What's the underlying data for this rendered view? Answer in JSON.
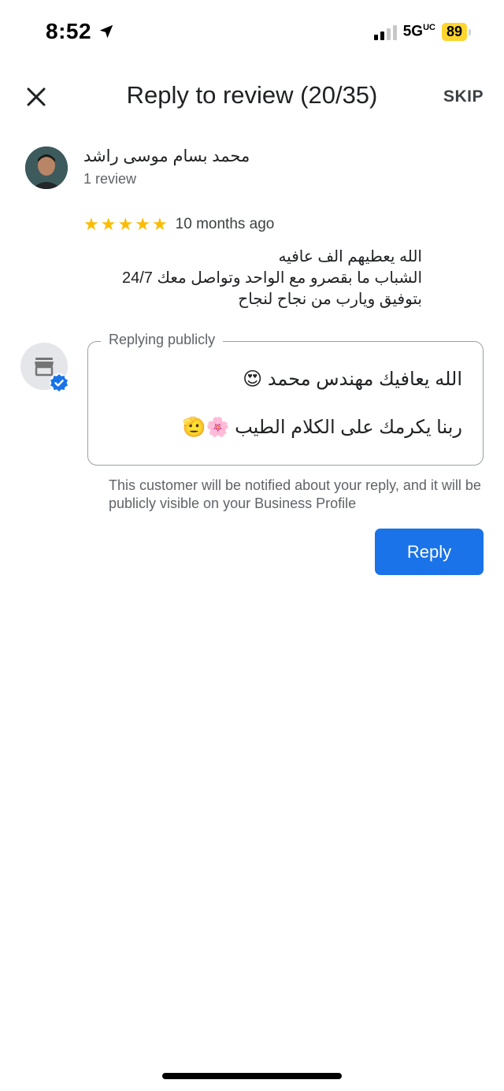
{
  "status_bar": {
    "time": "8:52",
    "network": "5G",
    "network_suffix": "UC",
    "battery": "89"
  },
  "header": {
    "title": "Reply to review (20/35)",
    "skip_label": "SKIP"
  },
  "review": {
    "reviewer_name": "محمد بسام موسى راشد",
    "reviewer_review_count": "1 review",
    "rating": 5,
    "time_ago": "10 months ago",
    "text_lines": [
      "الله يعطيهم الف عافيه",
      "الشباب ما بقصرو مع الواحد وتواصل معك 24/7",
      "بتوفيق ويارب من نجاح لنجاح"
    ]
  },
  "reply": {
    "legend": "Replying publicly",
    "lines": [
      "الله يعافيك مهندس محمد 😍",
      "ربنا يكرمك على الكلام الطيب 🌸🫡"
    ],
    "notice": "This customer will be notified about your reply, and it will be publicly visible on your Business Profile",
    "button_label": "Reply"
  },
  "colors": {
    "accent": "#1a73e8",
    "star": "#fbbc04",
    "battery": "#ffd52e"
  },
  "icons": [
    "location-arrow-icon",
    "close-icon",
    "star-icon",
    "store-icon",
    "verified-badge-icon"
  ]
}
